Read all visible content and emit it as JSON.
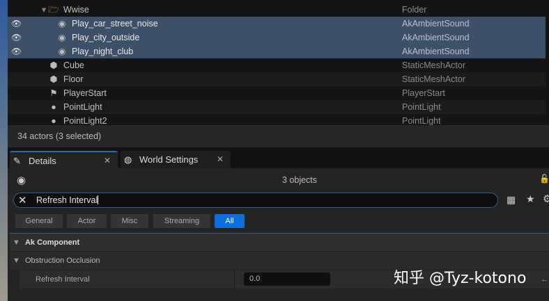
{
  "outliner": {
    "rows": [
      {
        "name": "Wwise",
        "type": "Folder",
        "icon": "folder-icon"
      },
      {
        "name": "Play_car_street_noise",
        "type": "AkAmbientSound",
        "icon": "ak-ambient-sound-icon",
        "selected": true
      },
      {
        "name": "Play_city_outside",
        "type": "AkAmbientSound",
        "icon": "ak-ambient-sound-icon",
        "selected": true
      },
      {
        "name": "Play_night_club",
        "type": "AkAmbientSound",
        "icon": "ak-ambient-sound-icon",
        "selected": true
      },
      {
        "name": "Cube",
        "type": "StaticMeshActor",
        "icon": "static-mesh-icon"
      },
      {
        "name": "Floor",
        "type": "StaticMeshActor",
        "icon": "static-mesh-icon"
      },
      {
        "name": "PlayerStart",
        "type": "PlayerStart",
        "icon": "player-start-icon"
      },
      {
        "name": "PointLight",
        "type": "PointLight",
        "icon": "point-light-icon"
      },
      {
        "name": "PointLight2",
        "type": "PointLight",
        "icon": "point-light-icon"
      }
    ],
    "status": "34 actors (3 selected)"
  },
  "tabs": [
    {
      "label": "Details"
    },
    {
      "label": "World Settings"
    }
  ],
  "details": {
    "count": "3 objects",
    "search_value": "Refresh Interval",
    "filters": [
      "General",
      "Actor",
      "Misc",
      "Streaming",
      "All"
    ],
    "category": "Ak Component",
    "subcategory": "Obstruction Occlusion",
    "property": {
      "label": "Refresh Interval",
      "value": "0.0"
    }
  },
  "watermark": "知乎 @Tyz-kotono"
}
